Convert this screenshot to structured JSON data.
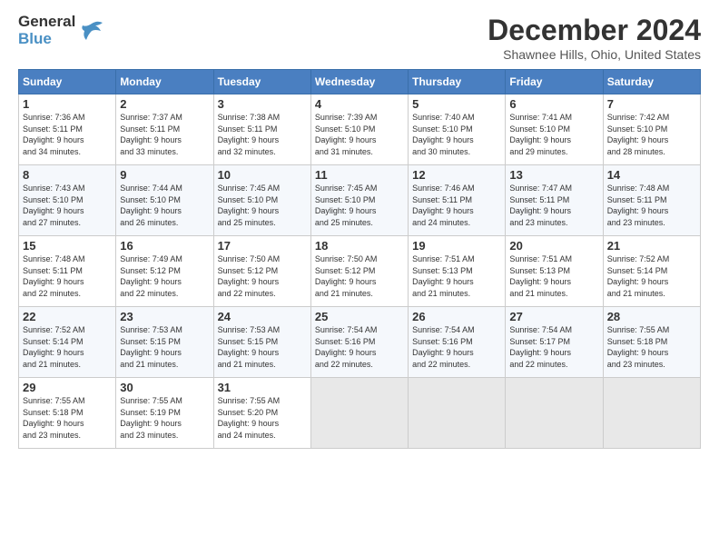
{
  "header": {
    "logo_line1": "General",
    "logo_line2": "Blue",
    "month_title": "December 2024",
    "location": "Shawnee Hills, Ohio, United States"
  },
  "weekdays": [
    "Sunday",
    "Monday",
    "Tuesday",
    "Wednesday",
    "Thursday",
    "Friday",
    "Saturday"
  ],
  "weeks": [
    [
      {
        "day": "1",
        "info": "Sunrise: 7:36 AM\nSunset: 5:11 PM\nDaylight: 9 hours\nand 34 minutes."
      },
      {
        "day": "2",
        "info": "Sunrise: 7:37 AM\nSunset: 5:11 PM\nDaylight: 9 hours\nand 33 minutes."
      },
      {
        "day": "3",
        "info": "Sunrise: 7:38 AM\nSunset: 5:11 PM\nDaylight: 9 hours\nand 32 minutes."
      },
      {
        "day": "4",
        "info": "Sunrise: 7:39 AM\nSunset: 5:10 PM\nDaylight: 9 hours\nand 31 minutes."
      },
      {
        "day": "5",
        "info": "Sunrise: 7:40 AM\nSunset: 5:10 PM\nDaylight: 9 hours\nand 30 minutes."
      },
      {
        "day": "6",
        "info": "Sunrise: 7:41 AM\nSunset: 5:10 PM\nDaylight: 9 hours\nand 29 minutes."
      },
      {
        "day": "7",
        "info": "Sunrise: 7:42 AM\nSunset: 5:10 PM\nDaylight: 9 hours\nand 28 minutes."
      }
    ],
    [
      {
        "day": "8",
        "info": "Sunrise: 7:43 AM\nSunset: 5:10 PM\nDaylight: 9 hours\nand 27 minutes."
      },
      {
        "day": "9",
        "info": "Sunrise: 7:44 AM\nSunset: 5:10 PM\nDaylight: 9 hours\nand 26 minutes."
      },
      {
        "day": "10",
        "info": "Sunrise: 7:45 AM\nSunset: 5:10 PM\nDaylight: 9 hours\nand 25 minutes."
      },
      {
        "day": "11",
        "info": "Sunrise: 7:45 AM\nSunset: 5:10 PM\nDaylight: 9 hours\nand 25 minutes."
      },
      {
        "day": "12",
        "info": "Sunrise: 7:46 AM\nSunset: 5:11 PM\nDaylight: 9 hours\nand 24 minutes."
      },
      {
        "day": "13",
        "info": "Sunrise: 7:47 AM\nSunset: 5:11 PM\nDaylight: 9 hours\nand 23 minutes."
      },
      {
        "day": "14",
        "info": "Sunrise: 7:48 AM\nSunset: 5:11 PM\nDaylight: 9 hours\nand 23 minutes."
      }
    ],
    [
      {
        "day": "15",
        "info": "Sunrise: 7:48 AM\nSunset: 5:11 PM\nDaylight: 9 hours\nand 22 minutes."
      },
      {
        "day": "16",
        "info": "Sunrise: 7:49 AM\nSunset: 5:12 PM\nDaylight: 9 hours\nand 22 minutes."
      },
      {
        "day": "17",
        "info": "Sunrise: 7:50 AM\nSunset: 5:12 PM\nDaylight: 9 hours\nand 22 minutes."
      },
      {
        "day": "18",
        "info": "Sunrise: 7:50 AM\nSunset: 5:12 PM\nDaylight: 9 hours\nand 21 minutes."
      },
      {
        "day": "19",
        "info": "Sunrise: 7:51 AM\nSunset: 5:13 PM\nDaylight: 9 hours\nand 21 minutes."
      },
      {
        "day": "20",
        "info": "Sunrise: 7:51 AM\nSunset: 5:13 PM\nDaylight: 9 hours\nand 21 minutes."
      },
      {
        "day": "21",
        "info": "Sunrise: 7:52 AM\nSunset: 5:14 PM\nDaylight: 9 hours\nand 21 minutes."
      }
    ],
    [
      {
        "day": "22",
        "info": "Sunrise: 7:52 AM\nSunset: 5:14 PM\nDaylight: 9 hours\nand 21 minutes."
      },
      {
        "day": "23",
        "info": "Sunrise: 7:53 AM\nSunset: 5:15 PM\nDaylight: 9 hours\nand 21 minutes."
      },
      {
        "day": "24",
        "info": "Sunrise: 7:53 AM\nSunset: 5:15 PM\nDaylight: 9 hours\nand 21 minutes."
      },
      {
        "day": "25",
        "info": "Sunrise: 7:54 AM\nSunset: 5:16 PM\nDaylight: 9 hours\nand 22 minutes."
      },
      {
        "day": "26",
        "info": "Sunrise: 7:54 AM\nSunset: 5:16 PM\nDaylight: 9 hours\nand 22 minutes."
      },
      {
        "day": "27",
        "info": "Sunrise: 7:54 AM\nSunset: 5:17 PM\nDaylight: 9 hours\nand 22 minutes."
      },
      {
        "day": "28",
        "info": "Sunrise: 7:55 AM\nSunset: 5:18 PM\nDaylight: 9 hours\nand 23 minutes."
      }
    ],
    [
      {
        "day": "29",
        "info": "Sunrise: 7:55 AM\nSunset: 5:18 PM\nDaylight: 9 hours\nand 23 minutes."
      },
      {
        "day": "30",
        "info": "Sunrise: 7:55 AM\nSunset: 5:19 PM\nDaylight: 9 hours\nand 23 minutes."
      },
      {
        "day": "31",
        "info": "Sunrise: 7:55 AM\nSunset: 5:20 PM\nDaylight: 9 hours\nand 24 minutes."
      },
      null,
      null,
      null,
      null
    ]
  ]
}
